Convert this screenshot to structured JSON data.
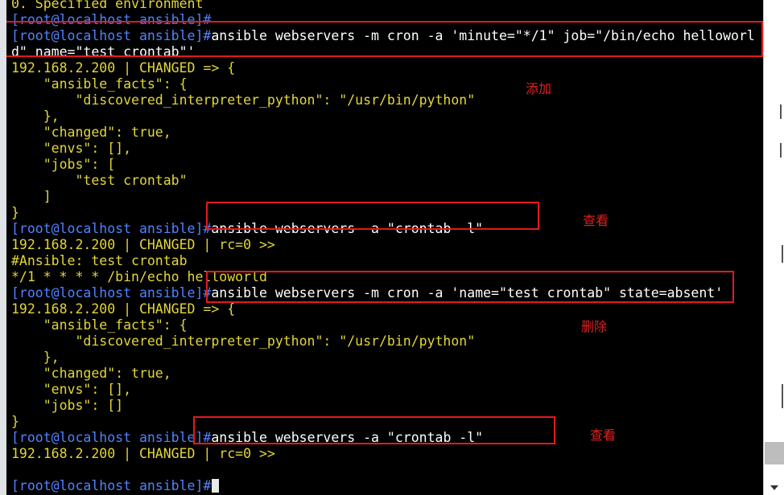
{
  "terminal": {
    "top_partial": "0. Specified environment",
    "prompt": "[root@localhost ansible]#",
    "cmd_add_1": "ansible webservers -m cron -a 'minute=\"*/1\" job=\"/bin/echo helloworl",
    "cmd_add_2": "d\" name=\"test crontab\"'",
    "changed_header": "192.168.2.200 | CHANGED => {",
    "facts_key": "    \"ansible_facts\": {",
    "facts_val": "        \"discovered_interpreter_python\": \"/usr/bin/python\"",
    "facts_close": "    },",
    "changed_true": "    \"changed\": true,",
    "envs": "    \"envs\": [],",
    "jobs_open": "    \"jobs\": [",
    "jobs_item": "        \"test crontab\"",
    "jobs_close": "    ]",
    "brace_close": "}",
    "cmd_list": "ansible webservers -a \"crontab -l\"",
    "rc_line": "192.168.2.200 | CHANGED | rc=0 >>",
    "comment_line": "#Ansible: test crontab",
    "cron_line": "*/1 * * * * /bin/echo helloworld",
    "cmd_remove": "ansible webservers -m cron -a 'name=\"test crontab\" state=absent'",
    "jobs_empty": "    \"jobs\": []",
    "colors": {
      "prompt": "#4f83ff",
      "output": "#e3d63a",
      "command": "#ffffff"
    }
  },
  "annotations": {
    "add": "添加",
    "view1": "查看",
    "delete": "删除",
    "view2": "查看",
    "box_color": "#e21b1b"
  }
}
